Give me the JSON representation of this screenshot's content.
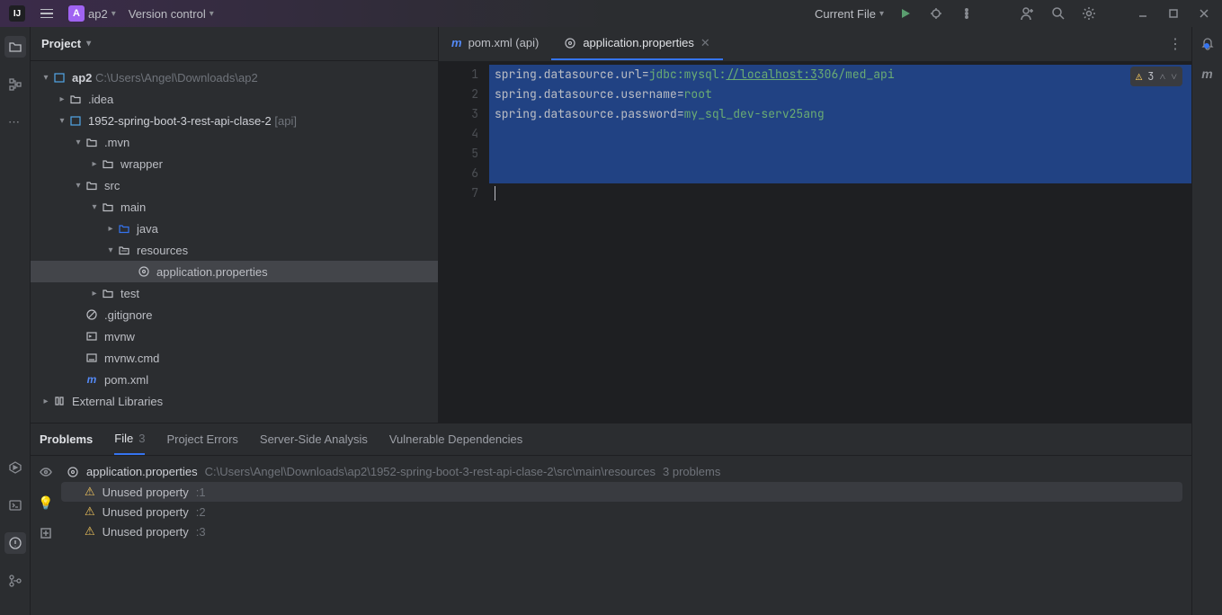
{
  "topbar": {
    "project_badge": "A",
    "project_name": "ap2",
    "vcs": "Version control",
    "run_config": "Current File"
  },
  "project": {
    "title": "Project",
    "root": {
      "name": "ap2",
      "path": "C:\\Users\\Angel\\Downloads\\ap2"
    },
    "idea": ".idea",
    "module": {
      "name": "1952-spring-boot-3-rest-api-clase-2",
      "scope": "[api]"
    },
    "mvn": ".mvn",
    "wrapper": "wrapper",
    "src": "src",
    "main": "main",
    "java": "java",
    "resources": "resources",
    "appprops": "application.properties",
    "test": "test",
    "gitignore": ".gitignore",
    "mvnw": "mvnw",
    "mvnwcmd": "mvnw.cmd",
    "pom": "pom.xml",
    "extlib": "External Libraries"
  },
  "tabs": {
    "pom": "pom.xml (api)",
    "props": "application.properties"
  },
  "editor": {
    "l1k": "spring.datasource.url",
    "l1v_pre": "jdbc:mysql:",
    "l1v_link": "//localhost:3",
    "l1v_post": "306/med_api",
    "l2k": "spring.datasource.username",
    "l2v": "root",
    "l3k": "spring.datasource.password",
    "l3v": "my_sql_dev-serv25ang",
    "warn_count": "3"
  },
  "problems": {
    "tab_problems": "Problems",
    "tab_file": "File",
    "tab_file_count": "3",
    "tab_errors": "Project Errors",
    "tab_server": "Server-Side Analysis",
    "tab_vuln": "Vulnerable Dependencies",
    "file": "application.properties",
    "path": "C:\\Users\\Angel\\Downloads\\ap2\\1952-spring-boot-3-rest-api-clase-2\\src\\main\\resources",
    "summary": "3 problems",
    "p1": "Unused property",
    "p1l": ":1",
    "p2": "Unused property",
    "p2l": ":2",
    "p3": "Unused property",
    "p3l": ":3"
  }
}
